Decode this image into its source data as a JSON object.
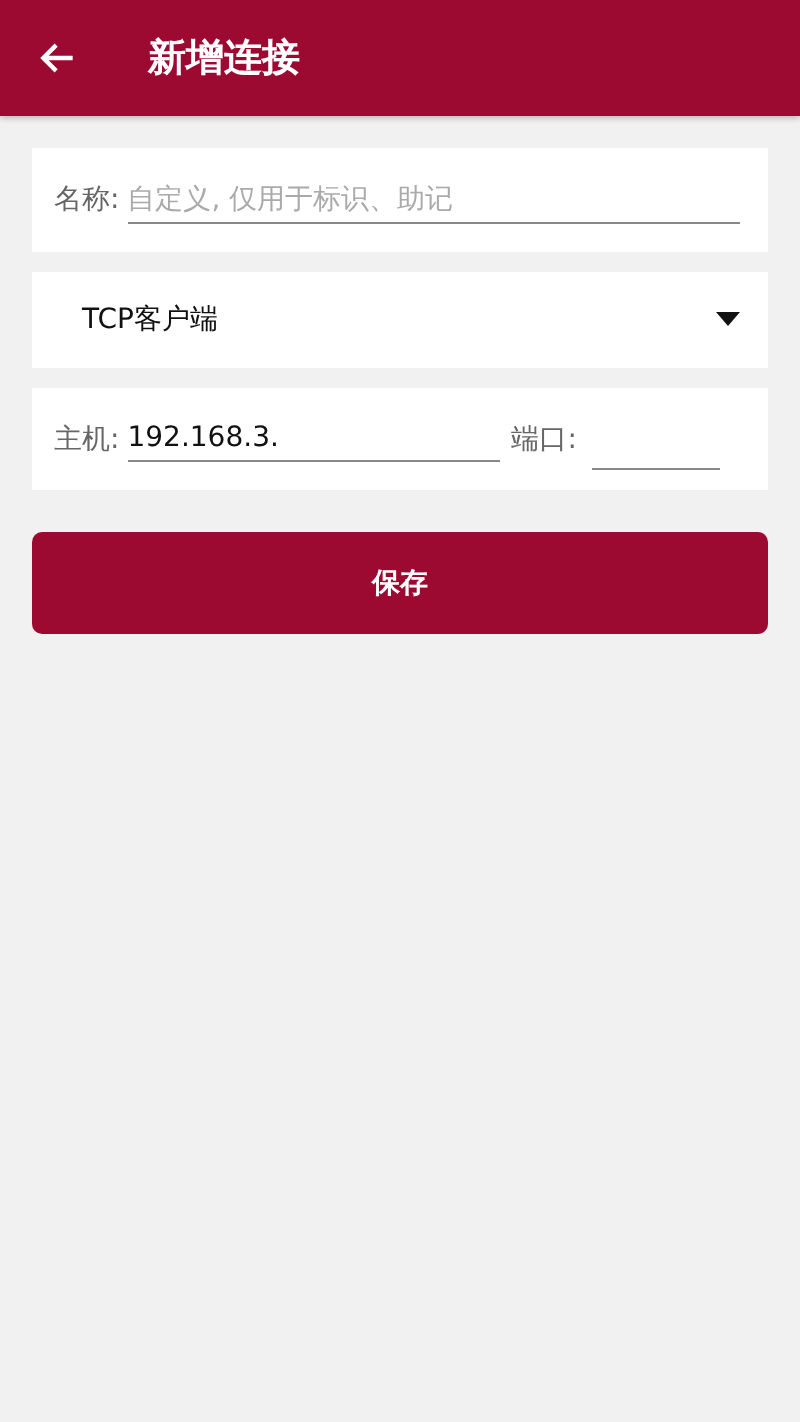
{
  "app_bar": {
    "title": "新增连接"
  },
  "name_field": {
    "label": "名称:",
    "placeholder": "自定义, 仅用于标识、助记"
  },
  "protocol_dropdown": {
    "value": "TCP客户端"
  },
  "host_field": {
    "label": "主机:",
    "value": "192.168.3."
  },
  "port_field": {
    "label": "端口:"
  },
  "save_button": {
    "label": "保存"
  }
}
